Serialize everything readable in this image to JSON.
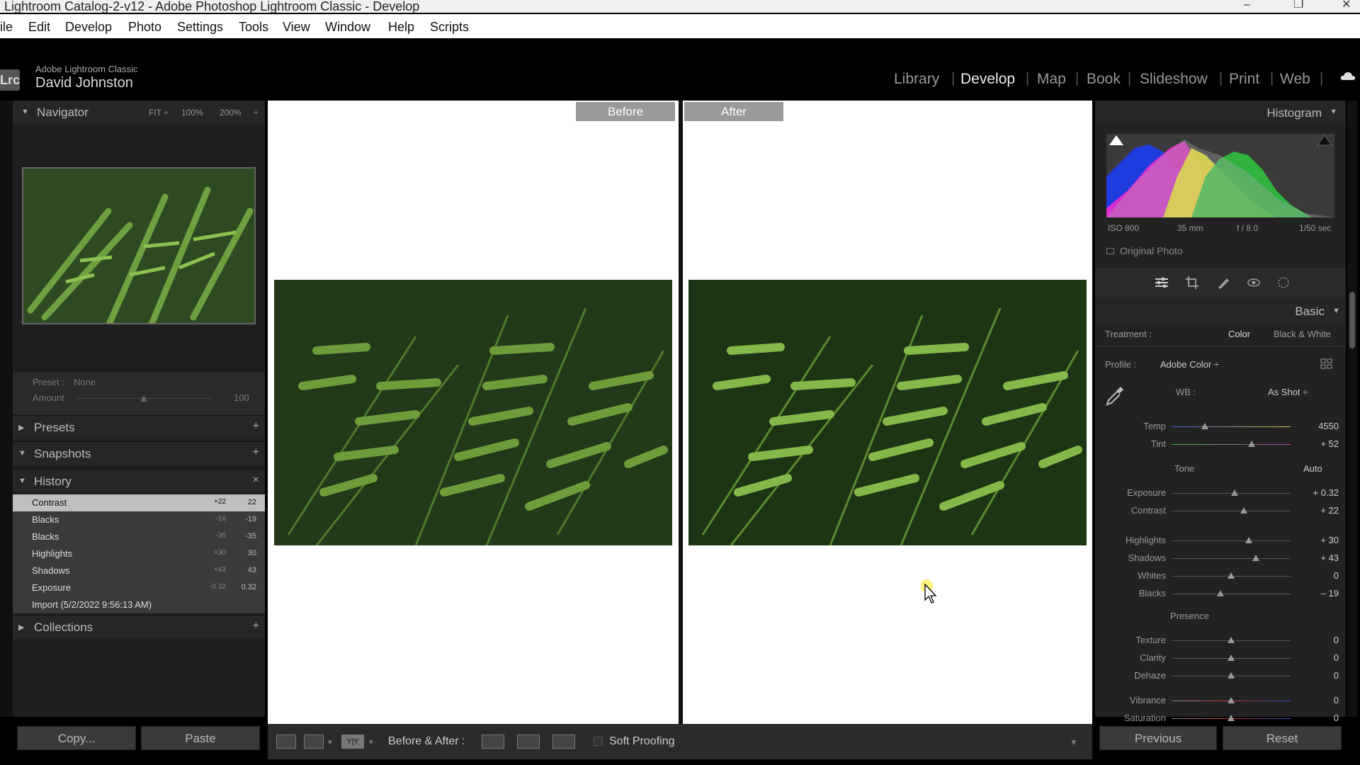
{
  "window": {
    "title": "Lightroom Catalog-2-v12 - Adobe Photoshop Lightroom Classic - Develop",
    "min": "–",
    "max": "❐",
    "close": "✕"
  },
  "menu": [
    "ile",
    "Edit",
    "Develop",
    "Photo",
    "Settings",
    "Tools",
    "View",
    "Window",
    "Help",
    "Scripts"
  ],
  "brand": {
    "logo": "Lrc",
    "app": "Adobe Lightroom Classic",
    "user": "David Johnston"
  },
  "modules": [
    "Library",
    "Develop",
    "Map",
    "Book",
    "Slideshow",
    "Print",
    "Web"
  ],
  "active_module": "Develop",
  "navigator": {
    "title": "Navigator",
    "zoom": [
      "FIT ÷",
      "100%",
      "200%",
      "÷"
    ]
  },
  "preset": {
    "label": "Preset :",
    "value": "None",
    "amount_label": "Amount",
    "amount": "100",
    "amount_level": 0.5
  },
  "sections": {
    "presets": "Presets",
    "snapshots": "Snapshots",
    "history": "History",
    "collections": "Collections"
  },
  "history": [
    {
      "label": "Contrast",
      "delta": "+22",
      "value": "22"
    },
    {
      "label": "Blacks",
      "delta": "-16",
      "value": "-19"
    },
    {
      "label": "Blacks",
      "delta": "-35",
      "value": "-35"
    },
    {
      "label": "Highlights",
      "delta": "+30",
      "value": "30"
    },
    {
      "label": "Shadows",
      "delta": "+43",
      "value": "43"
    },
    {
      "label": "Exposure",
      "delta": "-0.32",
      "value": "0.32"
    },
    {
      "label": "Import (5/2/2022 9:56:13 AM)",
      "delta": "",
      "value": ""
    }
  ],
  "left_buttons": {
    "copy": "Copy...",
    "paste": "Paste"
  },
  "viewer": {
    "before": "Before",
    "after": "After"
  },
  "toolbar": {
    "mode_label": "Before & After :",
    "soft_proofing": "Soft Proofing",
    "yy": "Y|Y"
  },
  "histogram": {
    "title": "Histogram",
    "iso": "ISO 800",
    "focal": "35 mm",
    "aperture": "f / 8.0",
    "shutter": "1/50 sec",
    "original": "Original Photo"
  },
  "basic": {
    "title": "Basic",
    "treatment_label": "Treatment :",
    "color": "Color",
    "bw": "Black & White",
    "profile_label": "Profile :",
    "profile": "Adobe Color ÷",
    "wb_label": "WB :",
    "wb": "As Shot ÷",
    "tone": "Tone",
    "auto": "Auto",
    "presence": "Presence"
  },
  "sliders": [
    {
      "label": "Temp",
      "value": "4550",
      "pos": 0.28,
      "group": "wb"
    },
    {
      "label": "Tint",
      "value": "+ 52",
      "pos": 0.67,
      "group": "wb"
    },
    {
      "label": "Exposure",
      "value": "+ 0.32",
      "pos": 0.53,
      "group": "tone"
    },
    {
      "label": "Contrast",
      "value": "+ 22",
      "pos": 0.61,
      "group": "tone"
    },
    {
      "label": "Highlights",
      "value": "+ 30",
      "pos": 0.65,
      "group": "tone"
    },
    {
      "label": "Shadows",
      "value": "+ 43",
      "pos": 0.71,
      "group": "tone"
    },
    {
      "label": "Whites",
      "value": "0",
      "pos": 0.5,
      "group": "tone"
    },
    {
      "label": "Blacks",
      "value": "– 19",
      "pos": 0.41,
      "group": "tone"
    },
    {
      "label": "Texture",
      "value": "0",
      "pos": 0.5,
      "group": "presence"
    },
    {
      "label": "Clarity",
      "value": "0",
      "pos": 0.5,
      "group": "presence"
    },
    {
      "label": "Dehaze",
      "value": "0",
      "pos": 0.5,
      "group": "presence"
    },
    {
      "label": "Vibrance",
      "value": "0",
      "pos": 0.5,
      "group": "presence"
    },
    {
      "label": "Saturation",
      "value": "0",
      "pos": 0.5,
      "group": "presence"
    }
  ],
  "right_buttons": {
    "previous": "Previous",
    "reset": "Reset"
  }
}
